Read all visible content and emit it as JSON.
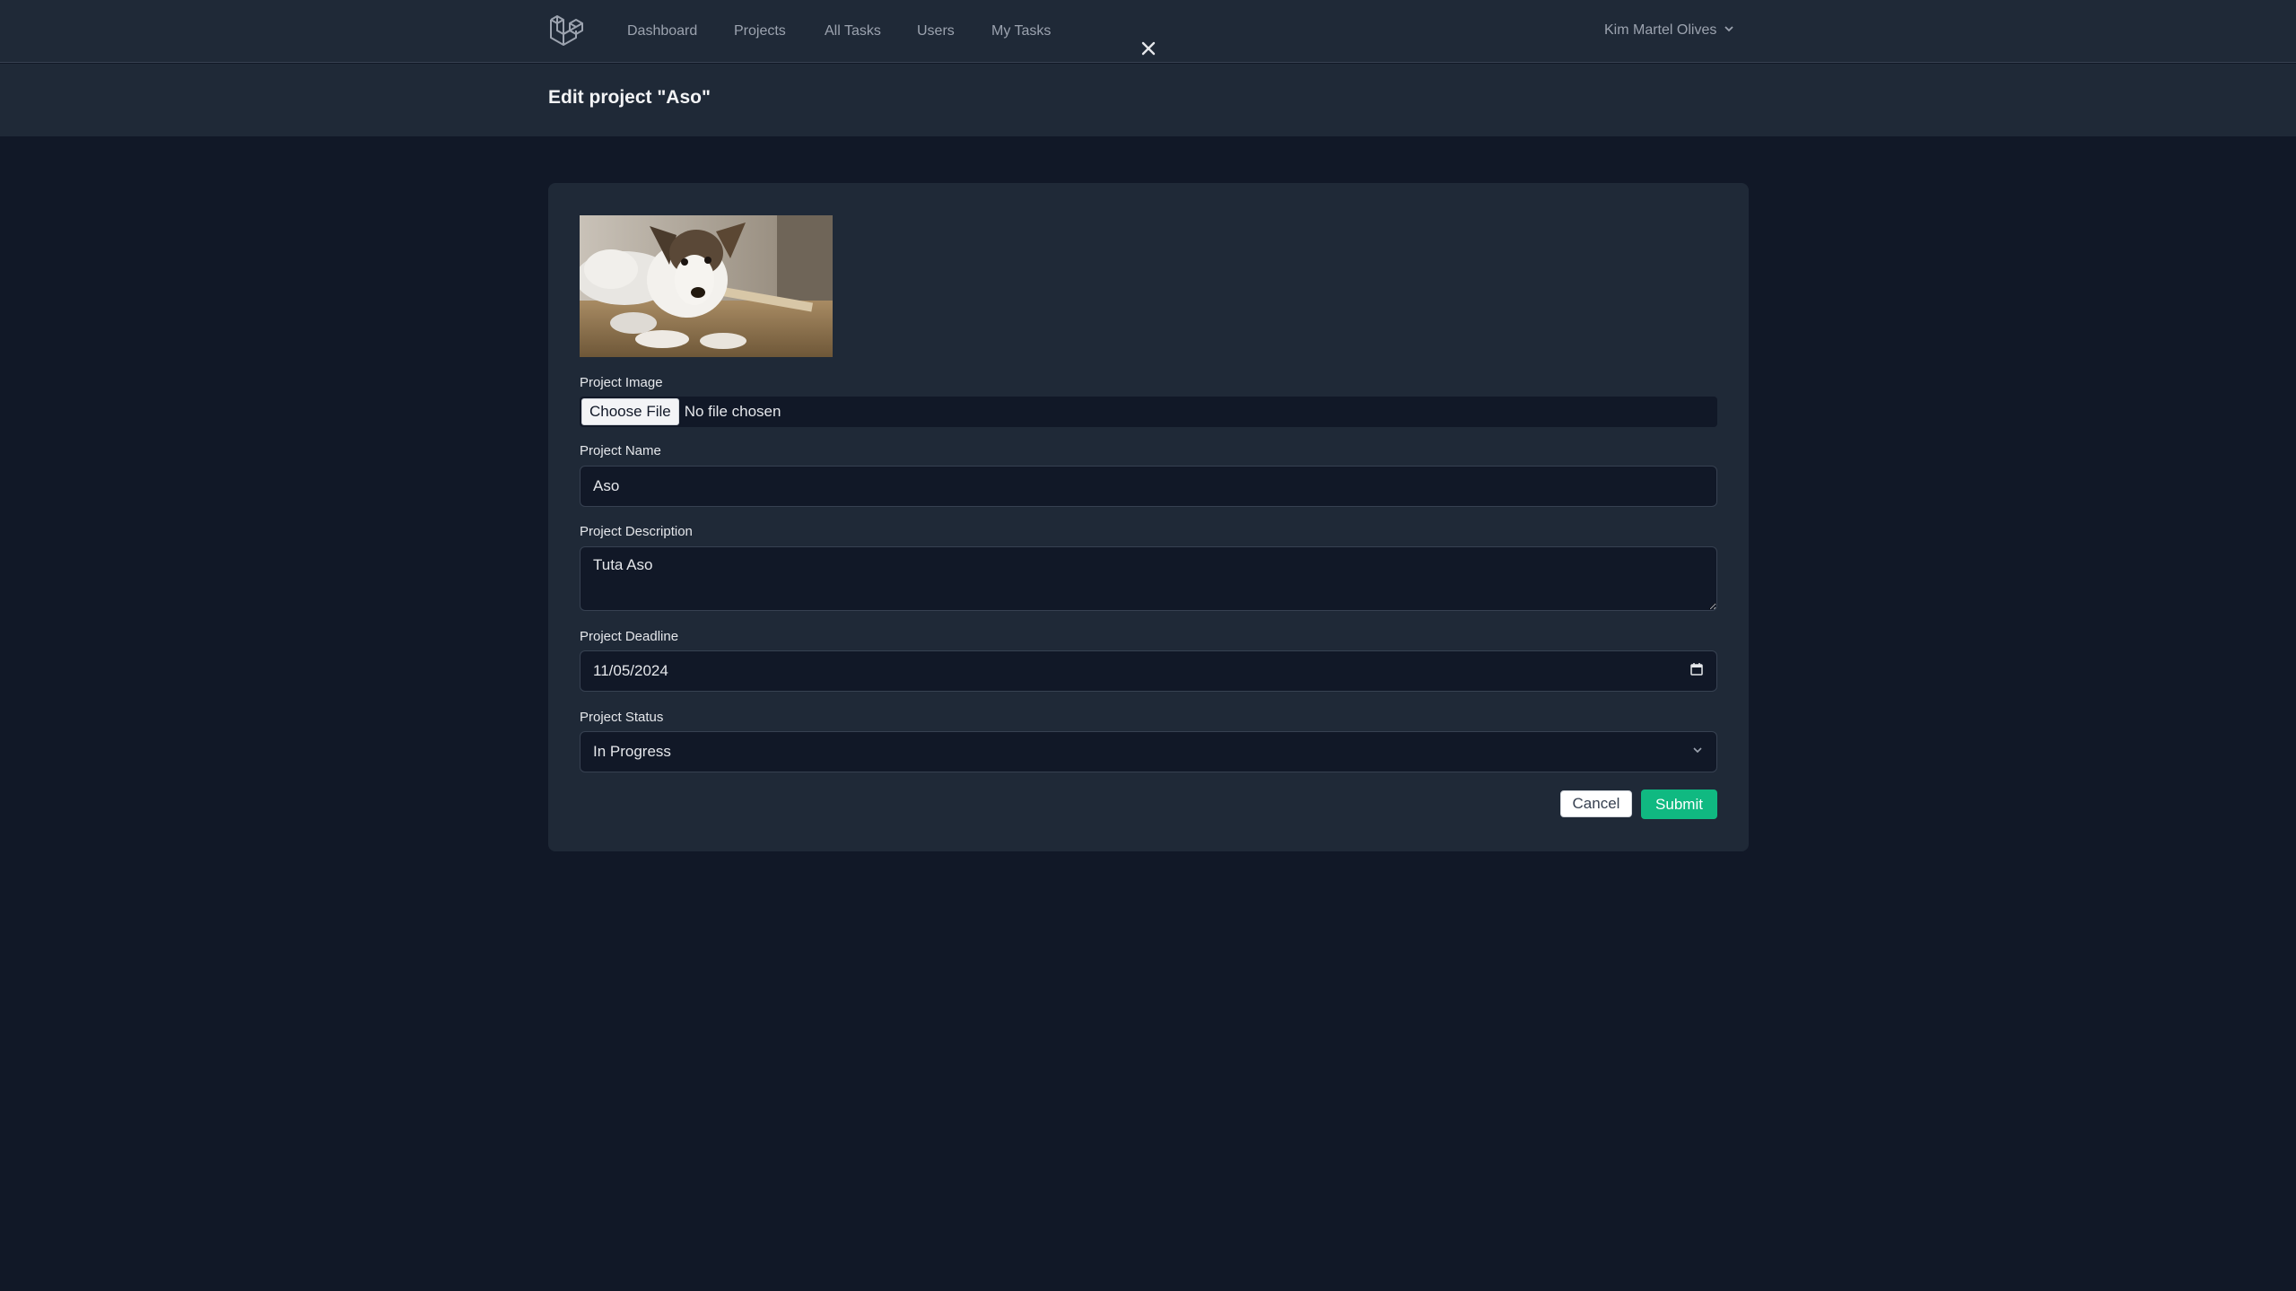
{
  "nav": {
    "links": [
      "Dashboard",
      "Projects",
      "All Tasks",
      "Users",
      "My Tasks"
    ],
    "user_name": "Kim Martel Olives"
  },
  "header": {
    "title": "Edit project \"Aso\""
  },
  "form": {
    "image_label": "Project Image",
    "choose_file_label": "Choose File",
    "file_status": "No file chosen",
    "name_label": "Project Name",
    "name_value": "Aso",
    "description_label": "Project Description",
    "description_value": "Tuta Aso",
    "deadline_label": "Project Deadline",
    "deadline_value": "11/05/2024",
    "status_label": "Project Status",
    "status_value": "In Progress",
    "cancel_label": "Cancel",
    "submit_label": "Submit"
  },
  "colors": {
    "page_bg": "#111827",
    "panel_bg": "#1f2937",
    "submit_green": "#10b981"
  },
  "icons": [
    "laravel-logo-icon",
    "close-icon",
    "chevron-down-icon",
    "calendar-icon"
  ]
}
